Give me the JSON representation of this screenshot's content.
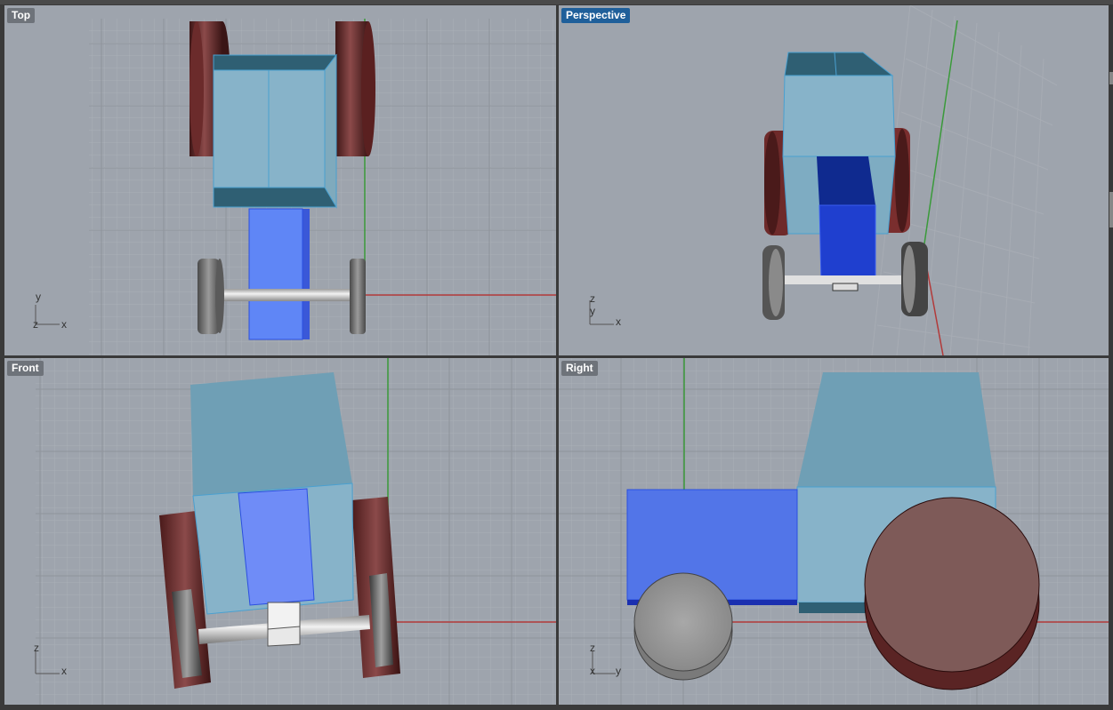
{
  "viewports": {
    "top": {
      "label": "Top",
      "axis_up": "y",
      "axis_right": "x",
      "axis_origin": "z"
    },
    "perspective": {
      "label": "Perspective",
      "axis_z": "z",
      "axis_y": "y",
      "axis_x": "x"
    },
    "front": {
      "label": "Front",
      "axis_up": "z",
      "axis_right": "x"
    },
    "right": {
      "label": "Right",
      "axis_up": "z",
      "axis_left": "x",
      "axis_right": "y"
    }
  },
  "active_viewport": "perspective",
  "colors": {
    "background": "#9ea4ad",
    "grid_minor": "#a9aeb6",
    "grid_major": "#8e939b",
    "axis_x": "#b23a3a",
    "axis_y": "#3a9a3a",
    "cab": "#87b3c9",
    "cab_dark": "#2f5f73",
    "hood": "#5f86f6",
    "hood_dark": "#1f3fcf",
    "rear_wheel": "#6e2a2a",
    "front_wheel": "#7a7a7a",
    "axle": "#d8d8d8",
    "active_label": "#1f5f9a"
  }
}
